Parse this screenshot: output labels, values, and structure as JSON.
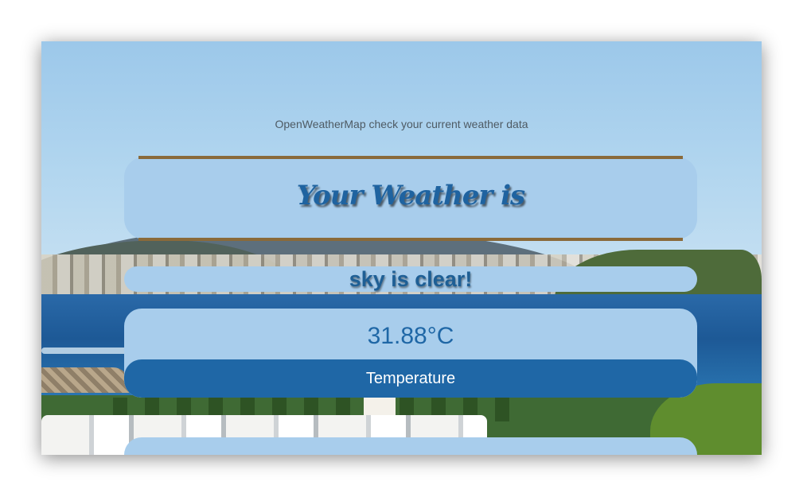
{
  "header": {
    "subtitle": "OpenWeatherMap check your current weather data"
  },
  "weather": {
    "title": "Your Weather is",
    "description": "sky is clear!",
    "temperature": "31.88°C",
    "temperature_label": "Temperature"
  },
  "colors": {
    "accent_blue": "#1f67a6",
    "card_bg": "#a8cdec",
    "rule_brown": "#8a6a3a"
  }
}
